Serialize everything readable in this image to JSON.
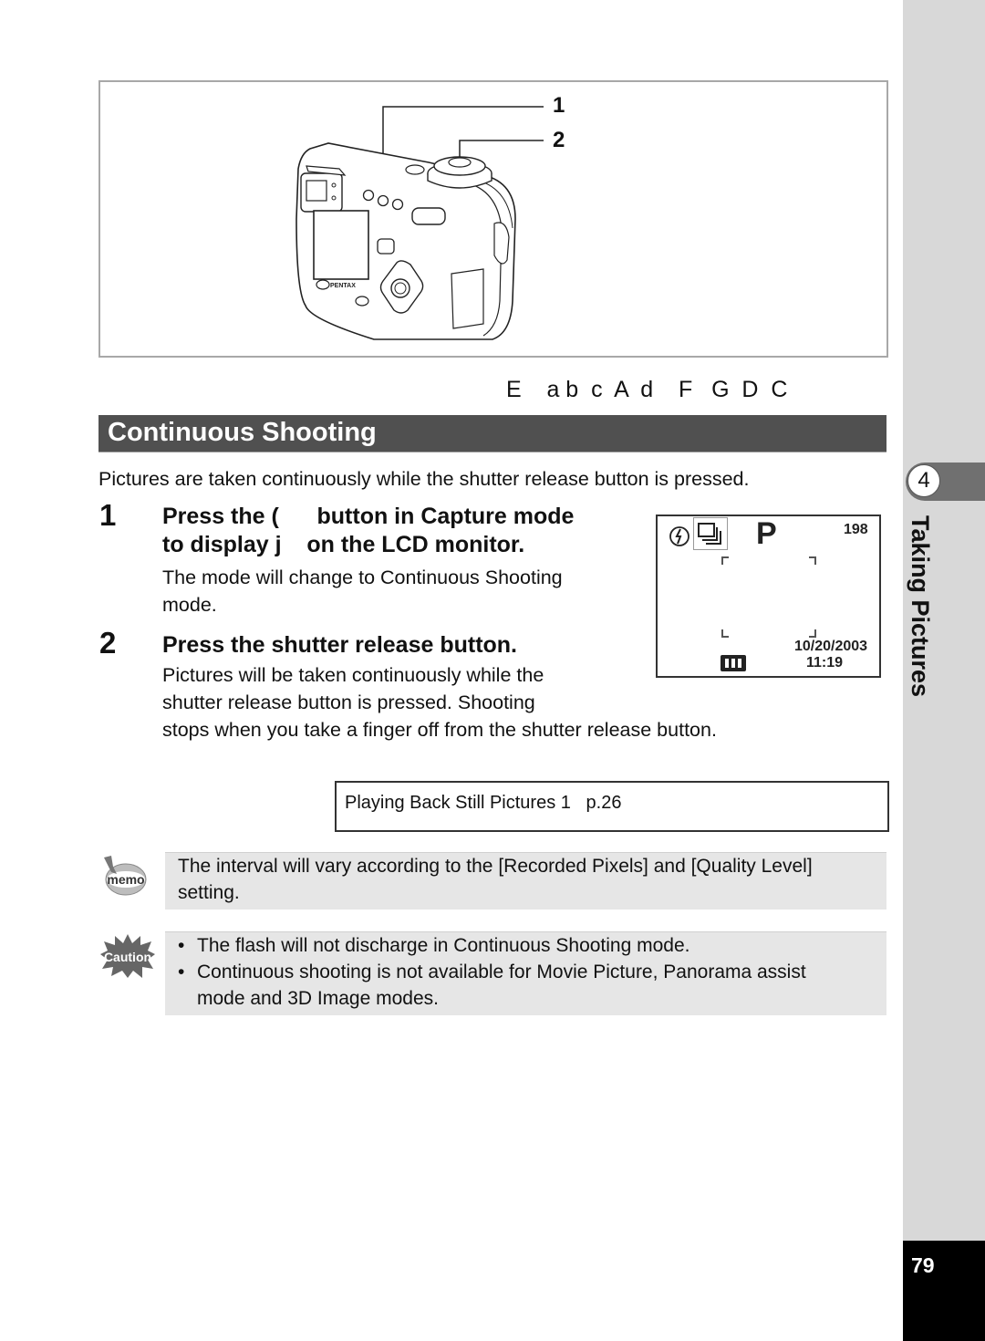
{
  "illustration": {
    "callouts": [
      "1",
      "2"
    ],
    "brand": "PENTAX"
  },
  "key_line": "E    a b  c  A  d    F   G  D  C",
  "section": {
    "title": "Continuous Shooting",
    "intro": "Pictures are taken continuously while the shutter release button is pressed."
  },
  "steps": [
    {
      "number": "1",
      "heading_line1": "Press the (      button in Capture mode",
      "heading_line2": "to display j    on the LCD monitor.",
      "body_lines": [
        "The mode will change to Continuous Shooting",
        "mode."
      ]
    },
    {
      "number": "2",
      "heading_line1": "Press the shutter release button.",
      "body_lines": [
        "Pictures will be taken continuously while the",
        "shutter release button is pressed. Shooting",
        "stops when you take a finger off from the shutter release button."
      ]
    }
  ],
  "lcd": {
    "mode": "P",
    "shots_remaining": "198",
    "date": "10/20/2003",
    "time": "11:19",
    "icons": [
      "flash-off-icon",
      "continuous-shooting-icon",
      "battery-full-icon"
    ]
  },
  "reference": {
    "text": "Playing Back Still Pictures 1   p.26"
  },
  "memo": {
    "badge": "memo",
    "lines": [
      "The interval will vary according to the [Recorded Pixels] and [Quality Level]",
      "setting."
    ]
  },
  "caution": {
    "badge": "Caution",
    "items": [
      {
        "line1": "The flash will not discharge in Continuous Shooting mode."
      },
      {
        "line1": "Continuous shooting is not available for Movie Picture, Panorama assist",
        "line2": "mode and 3D Image modes."
      }
    ],
    "bullet": "•"
  },
  "sidebar": {
    "chapter_number": "4",
    "chapter_title": "Taking Pictures",
    "page_number": "79"
  },
  "colors": {
    "title_bar": "#505050",
    "sidebar": "#d8d8d8",
    "note_bg": "#e6e6e6",
    "chapter_tab": "#707070"
  }
}
